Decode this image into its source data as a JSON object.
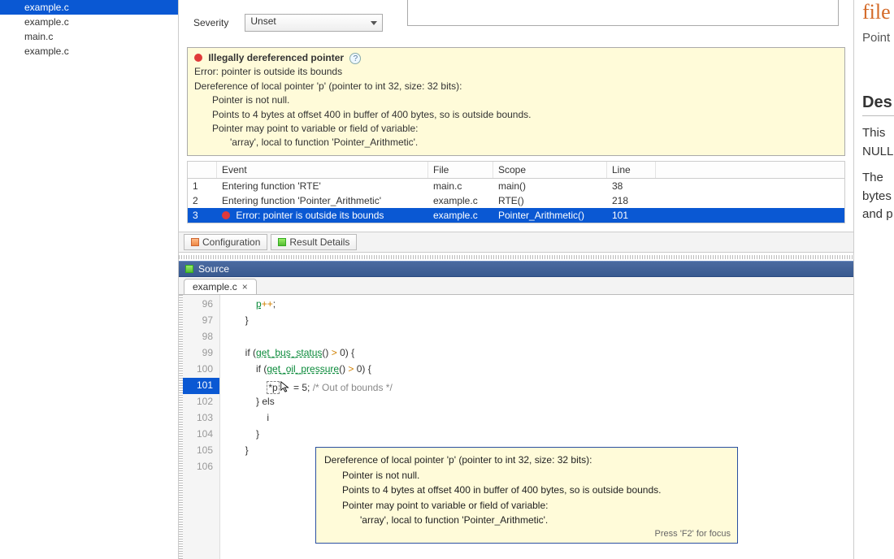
{
  "left_files": {
    "items": [
      "example.c",
      "example.c",
      "main.c",
      "example.c"
    ],
    "selected_index": 0
  },
  "severity": {
    "label": "Severity",
    "value": "Unset"
  },
  "diagnostic": {
    "title": "Illegally dereferenced pointer",
    "error_line": "Error: pointer is outside its bounds",
    "deref_line": "Dereference of local pointer 'p' (pointer to int 32, size: 32 bits):",
    "d1": "Pointer is not null.",
    "d2": "Points to 4 bytes at offset 400 in buffer of 400 bytes, so is outside bounds.",
    "d3": "Pointer may point to variable or field of variable:",
    "d4": "'array', local to function 'Pointer_Arithmetic'."
  },
  "events": {
    "headers": {
      "num": "",
      "event": "Event",
      "file": "File",
      "scope": "Scope",
      "line": "Line"
    },
    "rows": [
      {
        "num": "1",
        "event": "Entering function 'RTE'",
        "file": "main.c",
        "scope": "main()",
        "line": "38",
        "red": false
      },
      {
        "num": "2",
        "event": "Entering function 'Pointer_Arithmetic'",
        "file": "example.c",
        "scope": "RTE()",
        "line": "218",
        "red": false
      },
      {
        "num": "3",
        "event": "Error: pointer is outside its bounds",
        "file": "example.c",
        "scope": "Pointer_Arithmetic()",
        "line": "101",
        "red": true
      }
    ],
    "selected_index": 2
  },
  "bottom_tabs": {
    "configuration": "Configuration",
    "result_details": "Result Details"
  },
  "source_pane": {
    "title": "Source",
    "file_tab": "example.c"
  },
  "source": {
    "lines": [
      {
        "n": "96",
        "pre": "            ",
        "frag_a": "p",
        "frag_b": "++",
        "frag_c": ";"
      },
      {
        "n": "97",
        "pre": "        }"
      },
      {
        "n": "98",
        "pre": ""
      },
      {
        "n": "99",
        "pre": "        if (",
        "fn": "get_bus_status",
        "mid": "() ",
        "op": ">",
        "tail": " 0) {"
      },
      {
        "n": "100",
        "pre": "            if (",
        "fn": "get_oil_pressure",
        "mid": "() ",
        "op": ">",
        "tail": " 0) {"
      },
      {
        "n": "101",
        "pre": "                ",
        "sel": "*p",
        "mid2": " = 5; ",
        "cm": "/* Out of bounds */",
        "hl": true
      },
      {
        "n": "102",
        "pre": "            } els"
      },
      {
        "n": "103",
        "pre": "                i"
      },
      {
        "n": "104",
        "pre": "            }"
      },
      {
        "n": "105",
        "pre": "        }"
      },
      {
        "n": "106",
        "pre": ""
      }
    ]
  },
  "tooltip": {
    "l1": "Dereference of local pointer 'p' (pointer to int 32, size: 32 bits):",
    "l2": "Pointer is not null.",
    "l3": "Points to 4 bytes at offset 400 in buffer of 400 bytes, so is outside bounds.",
    "l4": "Pointer may point to variable or field of variable:",
    "l5": "'array', local to function 'Pointer_Arithmetic'.",
    "footer": "Press 'F2' for focus"
  },
  "right_panel": {
    "t1": "file",
    "t2": "Point",
    "h": "Des",
    "p1a": "This ",
    "p1b": "NULL",
    "p2a": "The ",
    "p2b": "bytes",
    "p2c": "and p"
  }
}
